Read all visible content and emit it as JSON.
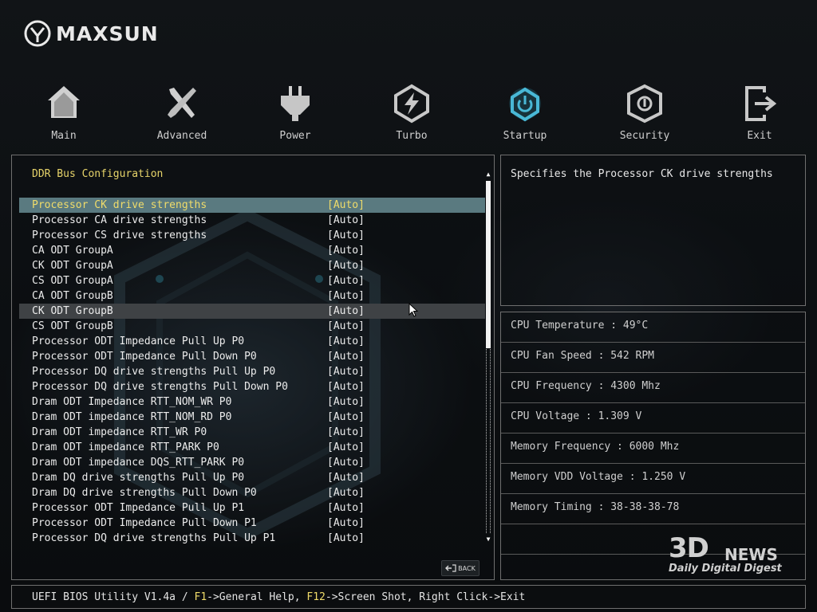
{
  "brand": {
    "name": "MAXSUN"
  },
  "nav": [
    {
      "id": "main",
      "label": "Main",
      "icon": "home-icon"
    },
    {
      "id": "advanced",
      "label": "Advanced",
      "icon": "tools-icon"
    },
    {
      "id": "power",
      "label": "Power",
      "icon": "power-plug-icon"
    },
    {
      "id": "turbo",
      "label": "Turbo",
      "icon": "lightning-icon"
    },
    {
      "id": "startup",
      "label": "Startup",
      "icon": "power-button-icon",
      "active": true
    },
    {
      "id": "security",
      "label": "Security",
      "icon": "security-shield-icon"
    },
    {
      "id": "exit",
      "label": "Exit",
      "icon": "exit-icon"
    }
  ],
  "section": {
    "title": "DDR Bus Configuration"
  },
  "settings": [
    {
      "label": "Processor CK drive strengths",
      "value": "[Auto]"
    },
    {
      "label": "Processor CA drive strengths",
      "value": "[Auto]"
    },
    {
      "label": "Processor CS drive strengths",
      "value": "[Auto]"
    },
    {
      "label": "CA ODT GroupA",
      "value": "[Auto]"
    },
    {
      "label": "CK ODT GroupA",
      "value": "[Auto]"
    },
    {
      "label": "CS ODT GroupA",
      "value": "[Auto]"
    },
    {
      "label": "CA ODT GroupB",
      "value": "[Auto]"
    },
    {
      "label": "CK ODT GroupB",
      "value": "[Auto]"
    },
    {
      "label": "CS ODT GroupB",
      "value": "[Auto]"
    },
    {
      "label": "Processor ODT Impedance Pull Up P0",
      "value": "[Auto]"
    },
    {
      "label": "Processor ODT Impedance Pull Down P0",
      "value": "[Auto]"
    },
    {
      "label": "Processor DQ drive strengths Pull Up P0",
      "value": "[Auto]"
    },
    {
      "label": "Processor DQ drive strengths Pull Down P0",
      "value": "[Auto]"
    },
    {
      "label": "Dram ODT Impedance RTT_NOM_WR P0",
      "value": "[Auto]"
    },
    {
      "label": "Dram ODT impedance RTT_NOM_RD P0",
      "value": "[Auto]"
    },
    {
      "label": "Dram ODT impedance RTT_WR P0",
      "value": "[Auto]"
    },
    {
      "label": "Dram ODT impedance RTT_PARK P0",
      "value": "[Auto]"
    },
    {
      "label": "Dram ODT impedance DQS_RTT_PARK P0",
      "value": "[Auto]"
    },
    {
      "label": "Dram DQ drive strengths Pull Up P0",
      "value": "[Auto]"
    },
    {
      "label": "Dram DQ drive strengths Pull Down P0",
      "value": "[Auto]"
    },
    {
      "label": "Processor ODT Impedance Pull Up P1",
      "value": "[Auto]"
    },
    {
      "label": "Processor ODT Impedance Pull Down P1",
      "value": "[Auto]"
    },
    {
      "label": "Processor DQ drive strengths Pull Up P1",
      "value": "[Auto]"
    }
  ],
  "selected_index": 0,
  "hover_index": 7,
  "back_button": {
    "label": "BACK"
  },
  "help": {
    "text": "Specifies the Processor CK drive strengths"
  },
  "status": [
    {
      "label": "CPU Temperature : 49°C"
    },
    {
      "label": "CPU Fan Speed : 542 RPM"
    },
    {
      "label": "CPU Frequency : 4300 Mhz"
    },
    {
      "label": "CPU Voltage : 1.309 V"
    },
    {
      "label": "Memory Frequency : 6000 Mhz"
    },
    {
      "label": "Memory VDD Voltage : 1.250 V"
    },
    {
      "label": "Memory Timing : 38-38-38-78"
    },
    {
      "label": ""
    }
  ],
  "watermark": {
    "big": "3D",
    "news": "NEWS",
    "sub": "Daily Digital Digest"
  },
  "footer": {
    "prefix": "UEFI BIOS Utility V1.4a / ",
    "key1": "F1",
    "text1": "->General Help, ",
    "key2": "F12",
    "text2": "->Screen Shot, Right Click->Exit"
  },
  "colors": {
    "accent": "#f0dc6a",
    "selected_row": "#5a7a80",
    "active_icon": "#49b8d6"
  }
}
